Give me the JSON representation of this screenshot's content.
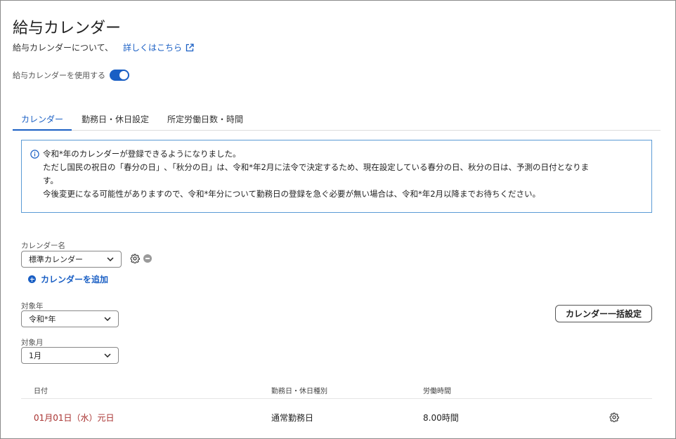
{
  "header": {
    "title": "給与カレンダー",
    "about_text": "給与カレンダーについて、",
    "about_link": "詳しくはこちら"
  },
  "toggle": {
    "label": "給与カレンダーを使用する",
    "on": true
  },
  "tabs": [
    {
      "label": "カレンダー",
      "active": true
    },
    {
      "label": "勤務日・休日設定",
      "active": false
    },
    {
      "label": "所定労働日数・時間",
      "active": false
    }
  ],
  "notice": {
    "lines": [
      "令和*年のカレンダーが登録できるようになりました。",
      "ただし国民の祝日の「春分の日」､「秋分の日」は、令和*年2月に法令で決定するため、現在設定している春分の日、秋分の日は、予測の日付となりま",
      "す。",
      "今後変更になる可能性がありますので、令和*年分について勤務日の登録を急ぐ必要が無い場合は、令和*年2月以降までお待ちください。"
    ]
  },
  "calendar": {
    "name_label": "カレンダー名",
    "name_value": "標準カレンダー",
    "add_label": "カレンダーを追加",
    "year_label": "対象年",
    "year_value": "令和*年",
    "month_label": "対象月",
    "month_value": "1月",
    "bulk_button": "カレンダー一括設定"
  },
  "table": {
    "headers": {
      "date": "日付",
      "type": "勤務日・休日種別",
      "hours": "労働時間"
    },
    "rows": [
      {
        "date": "01月01日（水）元日",
        "type": "通常勤務日",
        "hours": "8.00時間"
      }
    ]
  },
  "colors": {
    "accent": "#1a5fc4",
    "holiday": "#a8312f",
    "notice_border": "#5b9bd5"
  }
}
